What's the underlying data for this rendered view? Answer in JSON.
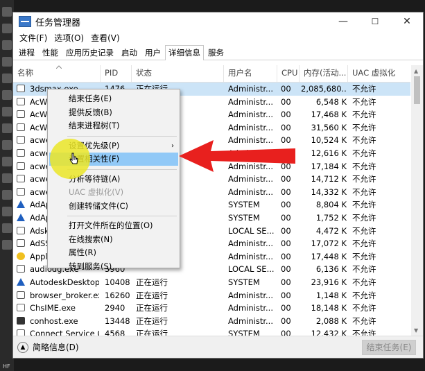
{
  "window": {
    "title": "任务管理器"
  },
  "window_controls": {
    "minimize": "—",
    "maximize": "☐",
    "close": "✕"
  },
  "menu": [
    "文件(F)",
    "选项(O)",
    "查看(V)"
  ],
  "tabs": [
    {
      "label": "进程"
    },
    {
      "label": "性能"
    },
    {
      "label": "应用历史记录"
    },
    {
      "label": "启动"
    },
    {
      "label": "用户"
    },
    {
      "label": "详细信息",
      "active": true
    },
    {
      "label": "服务"
    }
  ],
  "columns": [
    "名称",
    "PID",
    "状态",
    "用户名",
    "CPU",
    "内存(活动...",
    "UAC 虚拟化"
  ],
  "rows": [
    {
      "name": "3dsmax.exe",
      "pid": "1476",
      "status": "正在运行",
      "user": "Administr...",
      "cpu": "00",
      "mem": "2,085,680...",
      "uac": "不允许",
      "icon": "window",
      "selected": true
    },
    {
      "name": "AcWe",
      "pid": "",
      "status": "",
      "user": "Administr...",
      "cpu": "00",
      "mem": "6,548 K",
      "uac": "不允许",
      "icon": "window"
    },
    {
      "name": "AcWe",
      "pid": "",
      "status": "",
      "user": "Administr...",
      "cpu": "00",
      "mem": "17,468 K",
      "uac": "不允许",
      "icon": "window"
    },
    {
      "name": "AcWe",
      "pid": "",
      "status": "",
      "user": "Administr...",
      "cpu": "00",
      "mem": "31,560 K",
      "uac": "不允许",
      "icon": "window"
    },
    {
      "name": "acwel",
      "pid": "",
      "status": "",
      "user": "Administr...",
      "cpu": "00",
      "mem": "10,524 K",
      "uac": "不允许",
      "icon": "window"
    },
    {
      "name": "acwel",
      "pid": "",
      "status": "",
      "user": "Administr...",
      "cpu": "00",
      "mem": "12,616 K",
      "uac": "不允许",
      "icon": "window"
    },
    {
      "name": "acwel",
      "pid": "",
      "status": "",
      "user": "Administr...",
      "cpu": "00",
      "mem": "17,184 K",
      "uac": "不允许",
      "icon": "window"
    },
    {
      "name": "acwel",
      "pid": "",
      "status": "",
      "user": "Administr...",
      "cpu": "00",
      "mem": "14,712 K",
      "uac": "不允许",
      "icon": "window"
    },
    {
      "name": "acwel",
      "pid": "",
      "status": "",
      "user": "Administr...",
      "cpu": "00",
      "mem": "14,332 K",
      "uac": "不允许",
      "icon": "window"
    },
    {
      "name": "AdAp",
      "pid": "",
      "status": "",
      "user": "SYSTEM",
      "cpu": "00",
      "mem": "8,804 K",
      "uac": "不允许",
      "icon": "adobe"
    },
    {
      "name": "AdAp",
      "pid": "",
      "status": "",
      "user": "SYSTEM",
      "cpu": "00",
      "mem": "1,752 K",
      "uac": "不允许",
      "icon": "adobe"
    },
    {
      "name": "Adskl",
      "pid": "",
      "status": "",
      "user": "LOCAL SE...",
      "cpu": "00",
      "mem": "4,472 K",
      "uac": "不允许",
      "icon": "window"
    },
    {
      "name": "AdSS",
      "pid": "",
      "status": "",
      "user": "Administr...",
      "cpu": "00",
      "mem": "17,072 K",
      "uac": "不允许",
      "icon": "window"
    },
    {
      "name": "Applic",
      "pid": "",
      "status": "",
      "user": "Administr...",
      "cpu": "00",
      "mem": "17,448 K",
      "uac": "不允许",
      "icon": "sun"
    },
    {
      "name": "audiodg.exe",
      "pid": "3960",
      "status": "",
      "user": "LOCAL SE...",
      "cpu": "00",
      "mem": "6,136 K",
      "uac": "不允许",
      "icon": "window"
    },
    {
      "name": "AutodeskDesktop...",
      "pid": "10408",
      "status": "正在运行",
      "user": "SYSTEM",
      "cpu": "00",
      "mem": "23,916 K",
      "uac": "不允许",
      "icon": "adobe"
    },
    {
      "name": "browser_broker.exe",
      "pid": "16260",
      "status": "正在运行",
      "user": "Administr...",
      "cpu": "00",
      "mem": "1,148 K",
      "uac": "不允许",
      "icon": "window"
    },
    {
      "name": "ChsIME.exe",
      "pid": "2940",
      "status": "正在运行",
      "user": "Administr...",
      "cpu": "00",
      "mem": "18,148 K",
      "uac": "不允许",
      "icon": "ime"
    },
    {
      "name": "conhost.exe",
      "pid": "13448",
      "status": "正在运行",
      "user": "Administr...",
      "cpu": "00",
      "mem": "2,088 K",
      "uac": "不允许",
      "icon": "cmd"
    },
    {
      "name": "Connect Service Co...",
      "pid": "4568",
      "status": "正在运行",
      "user": "SYSTEM",
      "cpu": "00",
      "mem": "12,432 K",
      "uac": "不允许",
      "icon": "window"
    }
  ],
  "context_menu": [
    {
      "label": "结束任务(E)"
    },
    {
      "label": "提供反馈(B)"
    },
    {
      "label": "结束进程树(T)"
    },
    {
      "sep": true
    },
    {
      "label": "设置优先级(P)",
      "submenu": true,
      "arrow": "›"
    },
    {
      "label": "设置相关性(F)",
      "highlighted": true
    },
    {
      "sep": true
    },
    {
      "label": "分析等待链(A)"
    },
    {
      "label": "UAC 虚拟化(V)",
      "disabled": true
    },
    {
      "label": "创建转储文件(C)"
    },
    {
      "sep": true
    },
    {
      "label": "打开文件所在的位置(O)"
    },
    {
      "label": "在线搜索(N)"
    },
    {
      "label": "属性(R)"
    },
    {
      "label": "转到服务(S)"
    }
  ],
  "statusbar": {
    "less_details": "简略信息(D)",
    "end_task": "结束任务(E)"
  },
  "desktop_label": "HF",
  "colors": {
    "selection": "#cce4f7",
    "menu_highlight": "#91c9f7",
    "annotation_arrow": "#e8201e",
    "cursor_glow": "#ebe628"
  },
  "icons": {
    "app": "task-manager-icon",
    "sort": "sort-up-icon",
    "annotation": "red-arrow-icon"
  }
}
